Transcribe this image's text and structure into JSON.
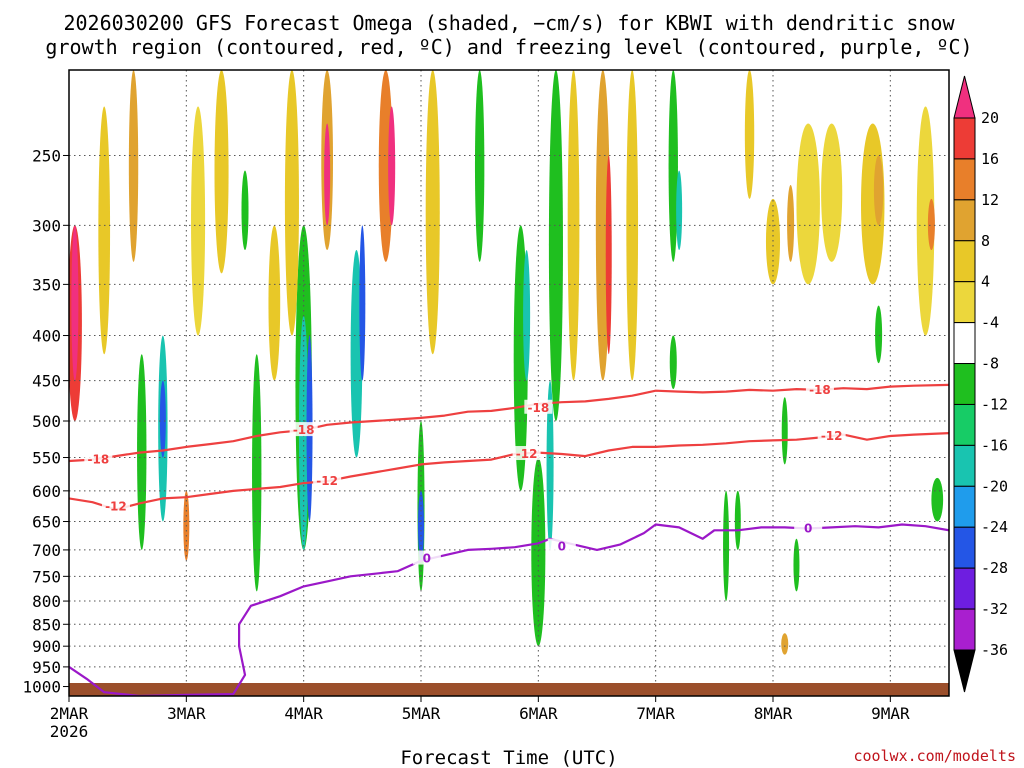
{
  "chart_data": {
    "type": "heatmap",
    "title_lines": [
      "2026030200 GFS Forecast Omega (shaded, −cm/s) for KBWI with dendritic snow",
      "growth region (contoured, red, ºC) and freezing level (contoured, purple, ºC)"
    ],
    "xlabel": "Forecast Time (UTC)",
    "credit": "coolwx.com/modelts",
    "x_ticks": [
      "2MAR",
      "3MAR",
      "4MAR",
      "5MAR",
      "6MAR",
      "7MAR",
      "8MAR",
      "9MAR"
    ],
    "x_tick_sub": "2026",
    "xlim_days": [
      0,
      7.5
    ],
    "y_ticks": [
      250,
      300,
      350,
      400,
      450,
      500,
      550,
      600,
      650,
      700,
      750,
      800,
      850,
      900,
      950,
      1000
    ],
    "y_scale": "log-pressure",
    "ylim_hpa": [
      1025,
      200
    ],
    "grid": "dotted",
    "colorbar_levels": [
      20,
      16,
      12,
      8,
      4,
      -4,
      -8,
      -12,
      -16,
      -20,
      -24,
      -28,
      -32,
      -36
    ],
    "colorbar_colors": [
      "#f0307f",
      "#ed3c36",
      "#e87f2a",
      "#e0a330",
      "#e8c828",
      "#ecd73c",
      "#ffffff",
      "#1fbf1f",
      "#17cc66",
      "#19c4b0",
      "#1f9cec",
      "#2456e6",
      "#6e1ee0",
      "#a91fcf",
      "#a8a8a8",
      "#000000"
    ],
    "contours": [
      {
        "name": "-18",
        "color": "#ee4040",
        "points": [
          [
            0,
            555
          ],
          [
            0.2,
            553
          ],
          [
            0.4,
            548
          ],
          [
            0.6,
            543
          ],
          [
            0.8,
            540
          ],
          [
            1.0,
            535
          ],
          [
            1.2,
            531
          ],
          [
            1.4,
            527
          ],
          [
            1.6,
            520
          ],
          [
            1.8,
            515
          ],
          [
            2.0,
            512
          ],
          [
            2.2,
            505
          ],
          [
            2.4,
            502
          ],
          [
            2.6,
            500
          ],
          [
            2.8,
            498
          ],
          [
            3.0,
            496
          ],
          [
            3.2,
            493
          ],
          [
            3.4,
            488
          ],
          [
            3.6,
            487
          ],
          [
            3.8,
            483
          ],
          [
            4.0,
            478
          ],
          [
            4.2,
            476
          ],
          [
            4.4,
            475
          ],
          [
            4.6,
            472
          ],
          [
            4.8,
            468
          ],
          [
            5.0,
            462
          ],
          [
            5.2,
            463
          ],
          [
            5.4,
            464
          ],
          [
            5.6,
            463
          ],
          [
            5.8,
            461
          ],
          [
            6.0,
            462
          ],
          [
            6.2,
            460
          ],
          [
            6.4,
            461
          ],
          [
            6.6,
            459
          ],
          [
            6.8,
            460
          ],
          [
            7.0,
            457
          ],
          [
            7.2,
            456
          ],
          [
            7.5,
            455
          ]
        ],
        "labels": [
          [
            0.25,
            553
          ],
          [
            2.0,
            512
          ],
          [
            4.0,
            483
          ],
          [
            6.4,
            461
          ]
        ]
      },
      {
        "name": "-12",
        "color": "#ee4040",
        "points": [
          [
            0,
            612
          ],
          [
            0.2,
            618
          ],
          [
            0.4,
            630
          ],
          [
            0.6,
            620
          ],
          [
            0.8,
            612
          ],
          [
            1.0,
            610
          ],
          [
            1.2,
            605
          ],
          [
            1.4,
            600
          ],
          [
            1.6,
            597
          ],
          [
            1.8,
            594
          ],
          [
            2.0,
            588
          ],
          [
            2.2,
            585
          ],
          [
            2.4,
            578
          ],
          [
            2.6,
            572
          ],
          [
            2.8,
            566
          ],
          [
            3.0,
            560
          ],
          [
            3.2,
            557
          ],
          [
            3.4,
            555
          ],
          [
            3.6,
            553
          ],
          [
            3.8,
            545
          ],
          [
            4.0,
            543
          ],
          [
            4.2,
            545
          ],
          [
            4.4,
            548
          ],
          [
            4.6,
            540
          ],
          [
            4.8,
            535
          ],
          [
            5.0,
            535
          ],
          [
            5.2,
            533
          ],
          [
            5.4,
            532
          ],
          [
            5.6,
            530
          ],
          [
            5.8,
            527
          ],
          [
            6.0,
            526
          ],
          [
            6.2,
            525
          ],
          [
            6.4,
            522
          ],
          [
            6.6,
            518
          ],
          [
            6.8,
            525
          ],
          [
            7.0,
            520
          ],
          [
            7.2,
            518
          ],
          [
            7.5,
            516
          ]
        ],
        "labels": [
          [
            0.4,
            625
          ],
          [
            2.2,
            585
          ],
          [
            3.9,
            545
          ],
          [
            6.5,
            520
          ]
        ]
      },
      {
        "name": "0",
        "color": "#9b18c8",
        "points": [
          [
            0,
            950
          ],
          [
            0.15,
            980
          ],
          [
            0.3,
            1015
          ],
          [
            0.6,
            1025
          ],
          [
            1.0,
            1022
          ],
          [
            1.4,
            1020
          ],
          [
            1.5,
            970
          ],
          [
            1.45,
            900
          ],
          [
            1.45,
            850
          ],
          [
            1.55,
            810
          ],
          [
            1.8,
            790
          ],
          [
            2.0,
            770
          ],
          [
            2.2,
            760
          ],
          [
            2.4,
            750
          ],
          [
            2.6,
            745
          ],
          [
            2.8,
            740
          ],
          [
            3.0,
            720
          ],
          [
            3.2,
            710
          ],
          [
            3.4,
            700
          ],
          [
            3.6,
            698
          ],
          [
            3.8,
            695
          ],
          [
            4.0,
            688
          ],
          [
            4.1,
            680
          ],
          [
            4.3,
            690
          ],
          [
            4.5,
            700
          ],
          [
            4.7,
            690
          ],
          [
            4.9,
            670
          ],
          [
            5.0,
            655
          ],
          [
            5.2,
            660
          ],
          [
            5.4,
            680
          ],
          [
            5.5,
            665
          ],
          [
            5.7,
            665
          ],
          [
            5.9,
            660
          ],
          [
            6.1,
            660
          ],
          [
            6.3,
            662
          ],
          [
            6.5,
            660
          ],
          [
            6.7,
            658
          ],
          [
            6.9,
            660
          ],
          [
            7.1,
            655
          ],
          [
            7.3,
            658
          ],
          [
            7.5,
            665
          ]
        ],
        "labels": [
          [
            3.05,
            716
          ],
          [
            4.2,
            694
          ],
          [
            6.3,
            662
          ]
        ]
      }
    ],
    "shading_blobs": [
      {
        "x": 0.05,
        "p": [
          300,
          500
        ],
        "w": 0.12,
        "color": "#ed3c36"
      },
      {
        "x": 0.05,
        "p": [
          300,
          450
        ],
        "w": 0.06,
        "color": "#f0307f"
      },
      {
        "x": 0.3,
        "p": [
          220,
          420
        ],
        "w": 0.1,
        "color": "#e8c828"
      },
      {
        "x": 0.55,
        "p": [
          200,
          330
        ],
        "w": 0.08,
        "color": "#e0a330"
      },
      {
        "x": 0.62,
        "p": [
          420,
          700
        ],
        "w": 0.08,
        "color": "#1fbf1f"
      },
      {
        "x": 0.8,
        "p": [
          400,
          650
        ],
        "w": 0.08,
        "color": "#19c4b0"
      },
      {
        "x": 0.8,
        "p": [
          450,
          550
        ],
        "w": 0.04,
        "color": "#2456e6"
      },
      {
        "x": 1.0,
        "p": [
          600,
          720
        ],
        "w": 0.05,
        "color": "#e87f2a"
      },
      {
        "x": 1.1,
        "p": [
          220,
          400
        ],
        "w": 0.12,
        "color": "#ecd73c"
      },
      {
        "x": 1.3,
        "p": [
          200,
          340
        ],
        "w": 0.12,
        "color": "#e8c828"
      },
      {
        "x": 1.5,
        "p": [
          260,
          320
        ],
        "w": 0.06,
        "color": "#1fbf1f"
      },
      {
        "x": 1.6,
        "p": [
          420,
          780
        ],
        "w": 0.08,
        "color": "#1fbf1f"
      },
      {
        "x": 1.75,
        "p": [
          300,
          450
        ],
        "w": 0.1,
        "color": "#e8c828"
      },
      {
        "x": 2.0,
        "p": [
          300,
          700
        ],
        "w": 0.14,
        "color": "#1fbf1f"
      },
      {
        "x": 2.0,
        "p": [
          380,
          700
        ],
        "w": 0.08,
        "color": "#19c4b0"
      },
      {
        "x": 2.05,
        "p": [
          400,
          650
        ],
        "w": 0.04,
        "color": "#2456e6"
      },
      {
        "x": 1.9,
        "p": [
          200,
          400
        ],
        "w": 0.12,
        "color": "#e8c828"
      },
      {
        "x": 2.2,
        "p": [
          200,
          320
        ],
        "w": 0.1,
        "color": "#e0a330"
      },
      {
        "x": 2.2,
        "p": [
          230,
          300
        ],
        "w": 0.05,
        "color": "#f0307f"
      },
      {
        "x": 2.45,
        "p": [
          320,
          550
        ],
        "w": 0.1,
        "color": "#19c4b0"
      },
      {
        "x": 2.5,
        "p": [
          300,
          450
        ],
        "w": 0.04,
        "color": "#2456e6"
      },
      {
        "x": 2.7,
        "p": [
          200,
          330
        ],
        "w": 0.12,
        "color": "#e87f2a"
      },
      {
        "x": 2.75,
        "p": [
          220,
          300
        ],
        "w": 0.06,
        "color": "#f0307f"
      },
      {
        "x": 3.1,
        "p": [
          200,
          420
        ],
        "w": 0.12,
        "color": "#e8c828"
      },
      {
        "x": 3.0,
        "p": [
          500,
          780
        ],
        "w": 0.06,
        "color": "#1fbf1f"
      },
      {
        "x": 3.0,
        "p": [
          600,
          720
        ],
        "w": 0.03,
        "color": "#2456e6"
      },
      {
        "x": 3.5,
        "p": [
          200,
          330
        ],
        "w": 0.08,
        "color": "#1fbf1f"
      },
      {
        "x": 3.85,
        "p": [
          300,
          600
        ],
        "w": 0.12,
        "color": "#1fbf1f"
      },
      {
        "x": 3.9,
        "p": [
          320,
          450
        ],
        "w": 0.06,
        "color": "#19c4b0"
      },
      {
        "x": 4.0,
        "p": [
          550,
          900
        ],
        "w": 0.12,
        "color": "#1fbf1f"
      },
      {
        "x": 4.1,
        "p": [
          450,
          700
        ],
        "w": 0.06,
        "color": "#19c4b0"
      },
      {
        "x": 4.15,
        "p": [
          200,
          500
        ],
        "w": 0.12,
        "color": "#1fbf1f"
      },
      {
        "x": 4.3,
        "p": [
          200,
          450
        ],
        "w": 0.1,
        "color": "#e8c828"
      },
      {
        "x": 4.55,
        "p": [
          200,
          450
        ],
        "w": 0.12,
        "color": "#e0a330"
      },
      {
        "x": 4.6,
        "p": [
          250,
          420
        ],
        "w": 0.05,
        "color": "#ed3c36"
      },
      {
        "x": 4.8,
        "p": [
          200,
          450
        ],
        "w": 0.1,
        "color": "#e8c828"
      },
      {
        "x": 5.15,
        "p": [
          200,
          330
        ],
        "w": 0.08,
        "color": "#1fbf1f"
      },
      {
        "x": 5.2,
        "p": [
          260,
          320
        ],
        "w": 0.04,
        "color": "#19c4b0"
      },
      {
        "x": 5.6,
        "p": [
          600,
          800
        ],
        "w": 0.05,
        "color": "#1fbf1f"
      },
      {
        "x": 5.8,
        "p": [
          200,
          280
        ],
        "w": 0.08,
        "color": "#e8c828"
      },
      {
        "x": 6.0,
        "p": [
          280,
          350
        ],
        "w": 0.12,
        "color": "#e8c828"
      },
      {
        "x": 6.3,
        "p": [
          230,
          350
        ],
        "w": 0.2,
        "color": "#ecd73c"
      },
      {
        "x": 6.15,
        "p": [
          270,
          330
        ],
        "w": 0.06,
        "color": "#e0a330"
      },
      {
        "x": 6.5,
        "p": [
          230,
          330
        ],
        "w": 0.18,
        "color": "#ecd73c"
      },
      {
        "x": 6.85,
        "p": [
          230,
          350
        ],
        "w": 0.2,
        "color": "#e8c828"
      },
      {
        "x": 6.9,
        "p": [
          250,
          300
        ],
        "w": 0.08,
        "color": "#e0a330"
      },
      {
        "x": 7.3,
        "p": [
          220,
          400
        ],
        "w": 0.15,
        "color": "#ecd73c"
      },
      {
        "x": 7.35,
        "p": [
          280,
          320
        ],
        "w": 0.06,
        "color": "#e87f2a"
      },
      {
        "x": 6.1,
        "p": [
          470,
          560
        ],
        "w": 0.05,
        "color": "#1fbf1f"
      },
      {
        "x": 6.1,
        "p": [
          870,
          920
        ],
        "w": 0.06,
        "color": "#e0a330"
      },
      {
        "x": 6.2,
        "p": [
          680,
          780
        ],
        "w": 0.04,
        "color": "#1fbf1f"
      },
      {
        "x": 7.4,
        "p": [
          580,
          650
        ],
        "w": 0.1,
        "color": "#1fbf1f"
      },
      {
        "x": 6.9,
        "p": [
          370,
          430
        ],
        "w": 0.06,
        "color": "#1fbf1f"
      },
      {
        "x": 5.7,
        "p": [
          600,
          700
        ],
        "w": 0.05,
        "color": "#1fbf1f"
      },
      {
        "x": 5.15,
        "p": [
          400,
          460
        ],
        "w": 0.06,
        "color": "#1fbf1f"
      }
    ]
  }
}
